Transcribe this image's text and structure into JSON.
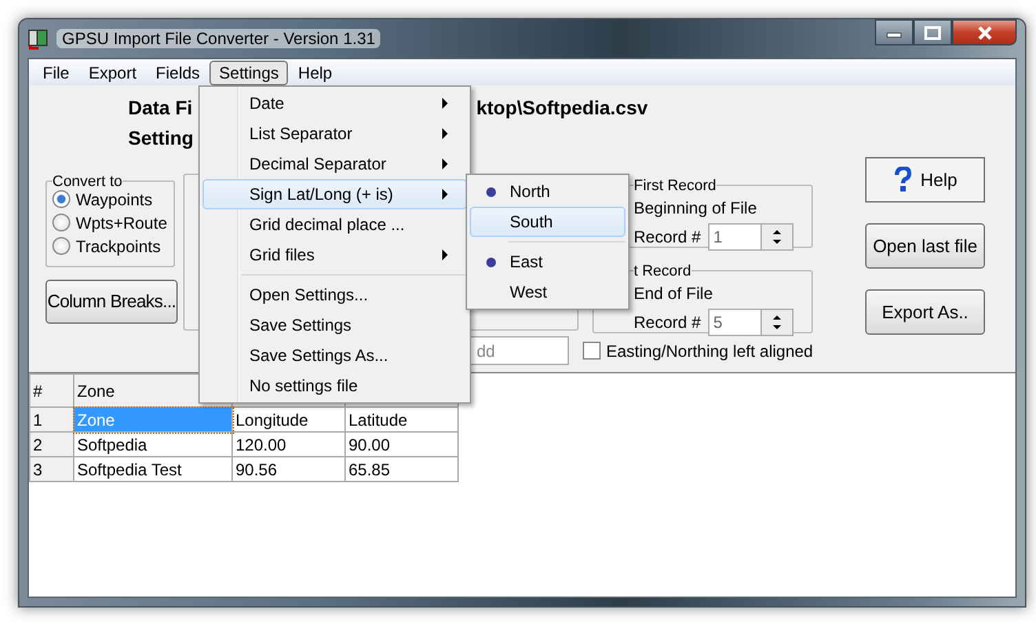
{
  "window": {
    "title": "GPSU Import File Converter - Version 1.31"
  },
  "menubar": [
    {
      "label": "File",
      "selected": false
    },
    {
      "label": "Export",
      "selected": false
    },
    {
      "label": "Fields",
      "selected": false
    },
    {
      "label": "Settings",
      "selected": true
    },
    {
      "label": "Help",
      "selected": false
    }
  ],
  "settings_menu": [
    {
      "kind": "item",
      "label": "Date",
      "submenu": true,
      "selected": false
    },
    {
      "kind": "item",
      "label": "List Separator",
      "submenu": true,
      "selected": false
    },
    {
      "kind": "item",
      "label": "Decimal Separator",
      "submenu": true,
      "selected": false
    },
    {
      "kind": "item",
      "label": "Sign Lat/Long (+ is)",
      "submenu": true,
      "selected": true
    },
    {
      "kind": "item",
      "label": "Grid decimal place ...",
      "submenu": false,
      "selected": false
    },
    {
      "kind": "item",
      "label": "Grid files",
      "submenu": true,
      "selected": false
    },
    {
      "kind": "separator"
    },
    {
      "kind": "item",
      "label": "Open Settings...",
      "submenu": false,
      "selected": false
    },
    {
      "kind": "item",
      "label": "Save Settings",
      "submenu": false,
      "selected": false
    },
    {
      "kind": "item",
      "label": "Save Settings As...",
      "submenu": false,
      "selected": false
    },
    {
      "kind": "item",
      "label": "No settings file",
      "submenu": false,
      "selected": false
    }
  ],
  "sign_submenu": [
    {
      "kind": "item",
      "label": "North",
      "checked": true,
      "selected": false
    },
    {
      "kind": "item",
      "label": "South",
      "checked": false,
      "selected": true
    },
    {
      "kind": "separator"
    },
    {
      "kind": "item",
      "label": "East",
      "checked": true,
      "selected": false
    },
    {
      "kind": "item",
      "label": "West",
      "checked": false,
      "selected": false
    }
  ],
  "header": {
    "data_file_label": "Data Fi",
    "data_file_path": "ktop\\Softpedia.csv",
    "settings_label": "Setting"
  },
  "convert_to": {
    "title": "Convert to",
    "options": [
      {
        "label": "Waypoints",
        "selected": true
      },
      {
        "label": "Wpts+Route",
        "selected": false
      },
      {
        "label": "Trackpoints",
        "selected": false
      }
    ]
  },
  "column_breaks_button": "Column Breaks...",
  "first_record": {
    "title": "First Record",
    "options": [
      {
        "label": "Beginning of File"
      },
      {
        "label": "Record #"
      }
    ],
    "value": "1"
  },
  "last_record": {
    "title": "t Record",
    "options": [
      {
        "label": "End of File"
      },
      {
        "label": "Record #"
      }
    ],
    "value": "5"
  },
  "format_field": {
    "placeholder": "dd"
  },
  "left_aligned": {
    "label": "Easting/Northing left aligned",
    "checked": false
  },
  "buttons": [
    {
      "kind": "help",
      "label": "Help"
    },
    {
      "kind": "plain",
      "label": "Open last file"
    },
    {
      "kind": "plain",
      "label": "Export As.."
    }
  ],
  "table": {
    "columns": [
      "#",
      "Zone"
    ],
    "rows": [
      {
        "cells": [
          {
            "text": "1",
            "selected": false
          },
          {
            "text": "Zone",
            "selected": true
          },
          {
            "text": "Longitude",
            "selected": false
          },
          {
            "text": "Latitude",
            "selected": false
          }
        ]
      },
      {
        "cells": [
          {
            "text": "2",
            "selected": false
          },
          {
            "text": "Softpedia",
            "selected": false
          },
          {
            "text": "120.00",
            "selected": false
          },
          {
            "text": "90.00",
            "selected": false
          }
        ]
      },
      {
        "cells": [
          {
            "text": "3",
            "selected": false
          },
          {
            "text": "Softpedia Test",
            "selected": false
          },
          {
            "text": "90.56",
            "selected": false
          },
          {
            "text": "65.85",
            "selected": false
          }
        ]
      }
    ]
  }
}
